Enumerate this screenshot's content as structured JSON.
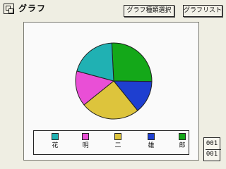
{
  "window": {
    "title": "グラフ"
  },
  "toolbar": {
    "graph_type_button": "グラフ種類選択",
    "graph_list_button": "グラフリスト"
  },
  "chart_data": {
    "type": "pie",
    "categories": [
      "花",
      "明",
      "二",
      "雄",
      "郎"
    ],
    "values": [
      20,
      15,
      25,
      14,
      26
    ],
    "colors": [
      "#20b1b3",
      "#e94fd6",
      "#ddc43c",
      "#1e3fd0",
      "#14a819"
    ],
    "title": ""
  },
  "legend": {
    "items": [
      {
        "label": "花",
        "color": "#20b1b3"
      },
      {
        "label": "明",
        "color": "#e94fd6"
      },
      {
        "label": "二",
        "color": "#ddc43c"
      },
      {
        "label": "雄",
        "color": "#1e3fd0"
      },
      {
        "label": "郎",
        "color": "#14a819"
      }
    ]
  },
  "page_counter": {
    "current": "001",
    "total": "001"
  }
}
